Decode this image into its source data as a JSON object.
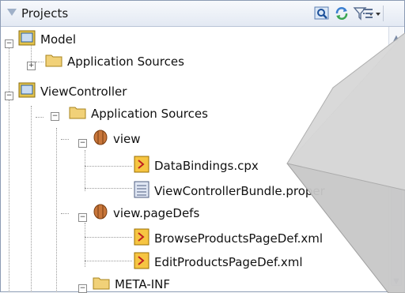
{
  "panel": {
    "title": "Projects"
  },
  "toolbar": {
    "icons": [
      "sync-with-editor-icon",
      "refresh-icon",
      "filter-icon",
      "view-options-icon"
    ]
  },
  "tree": {
    "items": [
      {
        "label": "Model",
        "icon": "project-icon",
        "expanded": true
      },
      {
        "label": "Application Sources",
        "icon": "folder-icon",
        "expanded": false
      },
      {
        "label": "ViewController",
        "icon": "project-icon",
        "expanded": true
      },
      {
        "label": "Application Sources",
        "icon": "folder-icon",
        "expanded": true
      },
      {
        "label": "view",
        "icon": "package-icon",
        "expanded": true
      },
      {
        "label": "DataBindings.cpx",
        "icon": "xml-file-icon"
      },
      {
        "label": "ViewControllerBundle.proper",
        "icon": "properties-file-icon"
      },
      {
        "label": "view.pageDefs",
        "icon": "package-icon",
        "expanded": true
      },
      {
        "label": "BrowseProductsPageDef.xml",
        "icon": "xml-file-icon"
      },
      {
        "label": "EditProductsPageDef.xml",
        "icon": "xml-file-icon"
      },
      {
        "label": "META-INF",
        "icon": "folder-icon",
        "expanded": true
      }
    ]
  },
  "colors": {
    "accent": "#8c9bb4",
    "callout": "#bdbdbd"
  }
}
